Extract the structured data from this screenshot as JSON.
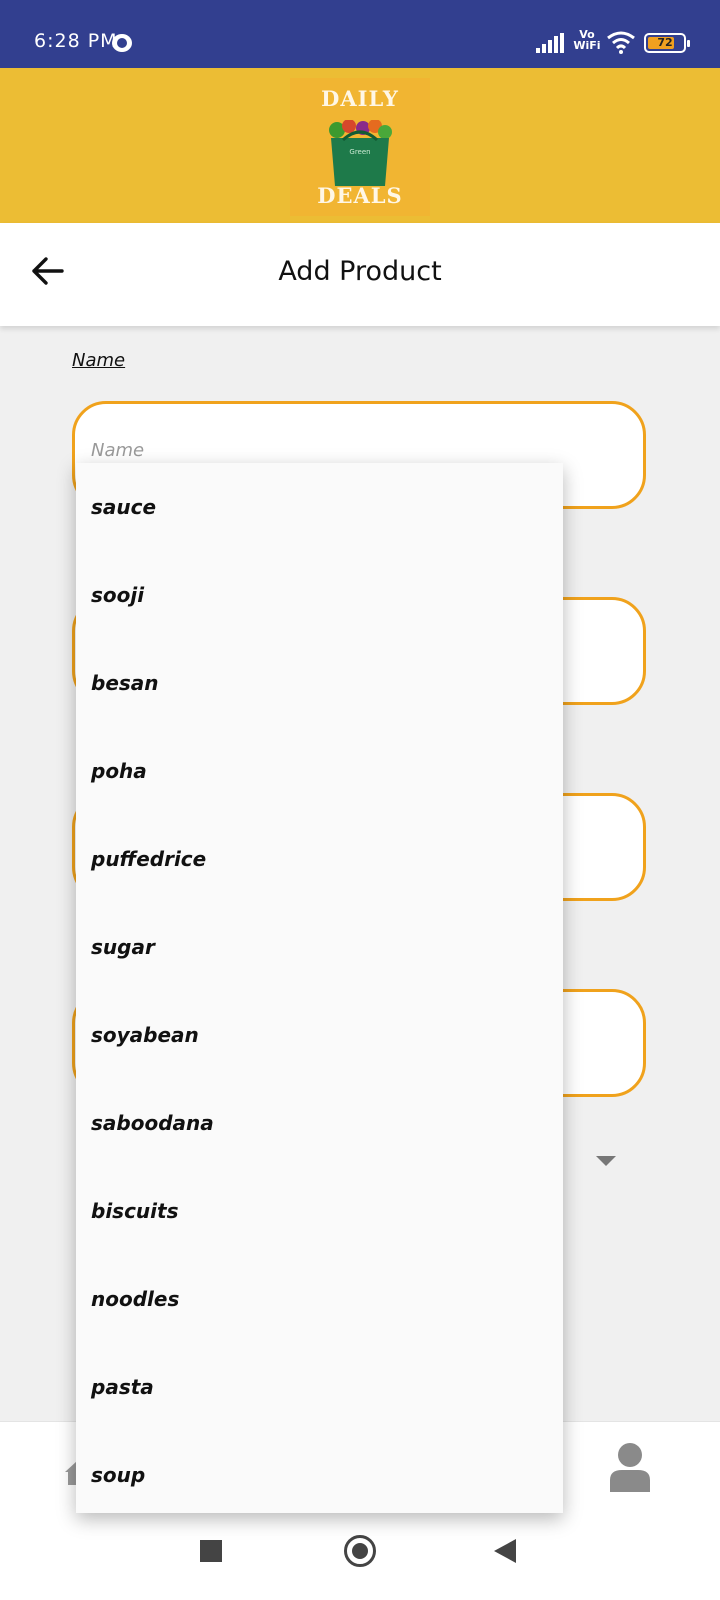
{
  "status_bar": {
    "time": "6:28 PM",
    "vowifi_top": "Vo",
    "vowifi_bottom": "WiFi",
    "battery_level": "72"
  },
  "brand": {
    "logo_top": "DAILY",
    "logo_bottom": "DEALS",
    "bag_label": "Green"
  },
  "header": {
    "title": "Add Product"
  },
  "form": {
    "name_label": "Name",
    "name_placeholder": "Name"
  },
  "dropdown": {
    "items": [
      "sauce",
      "sooji",
      "besan",
      "poha",
      "puffedrice",
      "sugar",
      "soyabean",
      "saboodana",
      "biscuits",
      "noodles",
      "pasta",
      "soup"
    ]
  },
  "colors": {
    "status_bar": "#323f8f",
    "banner": "#ecbd34",
    "field_border": "#f0a21c"
  },
  "icons": {
    "back": "arrow-left-icon",
    "home": "home-icon",
    "profile": "person-icon"
  }
}
